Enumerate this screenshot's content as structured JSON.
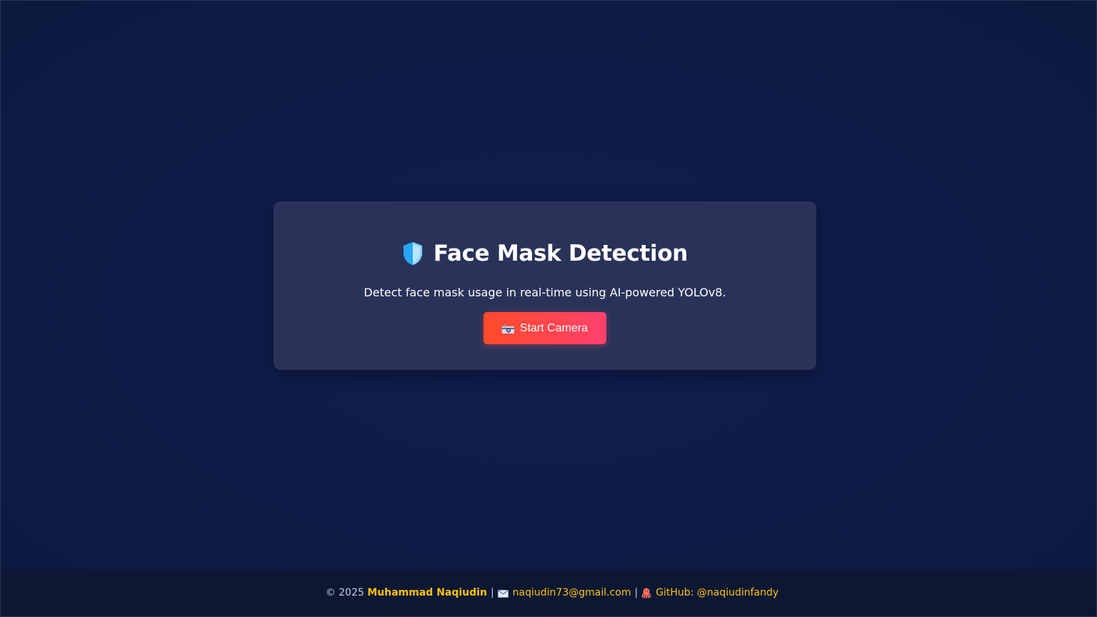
{
  "app": {
    "title": "Face Mask Detection",
    "subtitle": "Detect face mask usage in real-time using AI-powered YOLOv8.",
    "icon": "shield-icon"
  },
  "actions": {
    "start_camera_label": "Start Camera",
    "start_camera_icon": "camera-icon"
  },
  "footer": {
    "copyright": "© 2025",
    "author": "Muhammad Naqiudin",
    "separator": "|",
    "email": "naqiudin73@gmail.com",
    "email_icon": "mail-icon",
    "github_label": "GitHub: @naqiudinfandy",
    "github_icon": "octocat-icon"
  },
  "colors": {
    "background": "#0f1c49",
    "card": "#29335a",
    "button_start": "#ff4b2b",
    "button_end": "#ff416c",
    "accent": "#ffc107",
    "footer_bg": "#0c1733"
  }
}
